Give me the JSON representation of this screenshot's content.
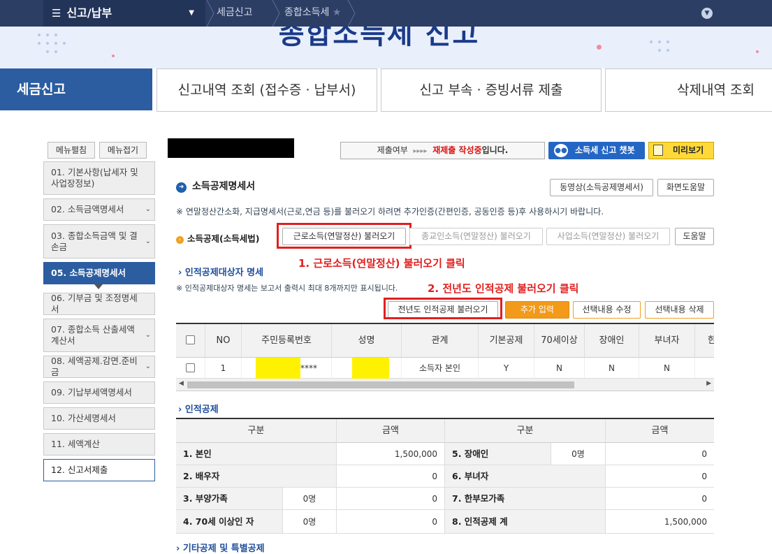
{
  "topnav": {
    "menu_label": "신고/납부",
    "crumb1": "세금신고",
    "crumb2": "종합소득세"
  },
  "hero": {
    "title": "종합소득세 신고"
  },
  "tabs": {
    "main": "세금신고",
    "t1": "신고내역 조회 (접수증 · 납부서)",
    "t2": "신고 부속 · 증빙서류 제출",
    "t3": "삭제내역 조회"
  },
  "sidebar": {
    "edit_btn": "메뉴펼침",
    "collapse_btn": "메뉴접기",
    "items": [
      "01. 기본사항(납세자 및 사업장정보)",
      "02. 소득금액명세서",
      "03. 종합소득금액 및 결손금",
      "05. 소득공제명세서",
      "06. 기부금 및 조정명세서",
      "07. 종합소득 산출세액계산서",
      "08. 세액공제.감면.준비금",
      "09. 기납부세액명세서",
      "10. 가산세명세서",
      "11. 세액계산",
      "12. 신고서제출"
    ]
  },
  "status": {
    "label": "제출여부",
    "arrows": "▸▸▸▸",
    "value": "재제출 작성중",
    "suffix": "입니다."
  },
  "buttons": {
    "chatbot": "소득세 신고 챗봇",
    "preview": "미리보기",
    "video": "동영상(소득공제명세서)",
    "help_screen": "화면도움말",
    "load_earned": "근로소득(연말정산) 불러오기",
    "load_religious": "종교인소득(연말정산) 불러오기",
    "load_business": "사업소득(연말정산) 불러오기",
    "help": "도움말",
    "load_prev": "전년도 인적공제 불러오기",
    "add": "추가 입력",
    "edit": "선택내용 수정",
    "delete": "선택내용 삭제"
  },
  "section": {
    "title": "소득공제명세서",
    "notice": "※ 연말정산간소화, 지급명세서(근로,연금 등)를 불러오기 하려면 추가인증(간편인증, 공동인증 등)후 사용하시기 바랍니다.",
    "deduction_label": "소득공제(소득세법)",
    "instr1": "1. 근로소득(연말정산) 불러오기 클릭",
    "instr2": "2. 전년도 인적공제 불러오기 클릭",
    "dependents_title": "인적공제대상자 명세",
    "dependents_note": "※ 인적공제대상자 명세는 보고서 출력시 최대 8개까지만 표시됩니다.",
    "personal_title": "인적공제",
    "next_title": "기타공제 및 특별공제"
  },
  "person_table": {
    "headers": [
      "NO",
      "주민등록번호",
      "성명",
      "관계",
      "기본공제",
      "70세이상",
      "장애인",
      "부녀자",
      "한"
    ],
    "row": {
      "no": "1",
      "ssn_tail": "****",
      "relation": "소득자 본인",
      "basic": "Y",
      "over70": "N",
      "disabled": "N",
      "woman": "N"
    }
  },
  "deduction_table": {
    "headers": [
      "구분",
      "금액",
      "구분",
      "금액"
    ],
    "rows": [
      {
        "l_label": "1. 본인",
        "l_count": "",
        "l_amount": "1,500,000",
        "r_label": "5. 장애인",
        "r_count": "0명",
        "r_amount": "0"
      },
      {
        "l_label": "2. 배우자",
        "l_count": "",
        "l_amount": "0",
        "r_label": "6. 부녀자",
        "r_count": "",
        "r_amount": "0"
      },
      {
        "l_label": "3. 부양가족",
        "l_count": "0명",
        "l_amount": "0",
        "r_label": "7. 한부모가족",
        "r_count": "",
        "r_amount": "0"
      },
      {
        "l_label": "4. 70세 이상인 자",
        "l_count": "0명",
        "l_amount": "0",
        "r_label": "8. 인적공제 계",
        "r_count": "",
        "r_amount": "1,500,000"
      }
    ]
  }
}
